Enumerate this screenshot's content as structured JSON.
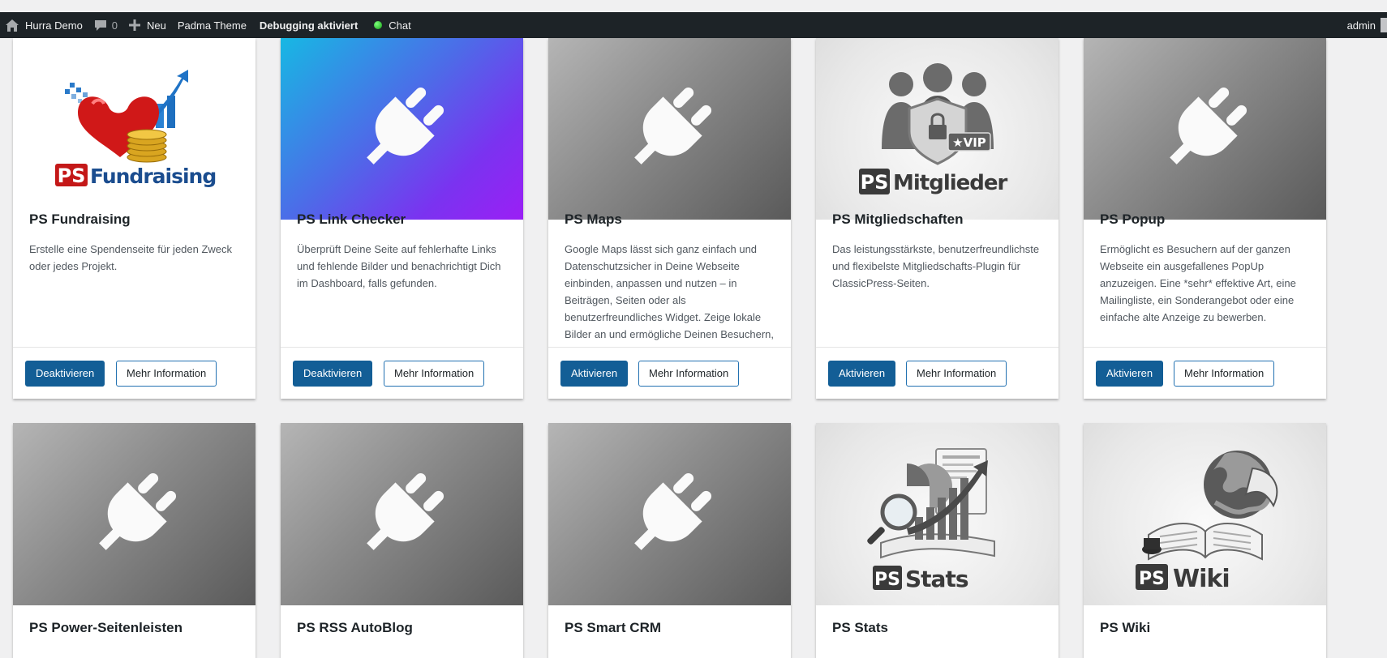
{
  "adminbar": {
    "site_name": "Hurra Demo",
    "comments_count": "0",
    "new_label": "Neu",
    "theme_label": "Padma Theme",
    "debugging_label": "Debugging aktiviert",
    "chat_label": "Chat",
    "user_label": "admin"
  },
  "labels": {
    "more_info": "Mehr Information",
    "activate": "Aktivieren",
    "deactivate": "Deaktivieren"
  },
  "plugins_row1": [
    {
      "name": "PS Fundraising",
      "description": "Erstelle eine Spendenseite für jeden Zweck oder jedes Projekt.",
      "action": "Deaktivieren",
      "thumbnail": "fundraising-logo",
      "logo_text": "Fundraising"
    },
    {
      "name": "PS Link Checker",
      "description": "Überprüft Deine Seite auf fehlerhafte Links und fehlende Bilder und benachrichtigt Dich im Dashboard, falls gefunden.",
      "action": "Deaktivieren",
      "thumbnail": "plug-icon"
    },
    {
      "name": "PS Maps",
      "description": "Google Maps lässt sich ganz einfach und Datenschutzsicher in Deine Webseite einbinden, anpassen und nutzen – in Beiträgen, Seiten oder als benutzerfreundliches Widget. Zeige lokale Bilder an und ermögliche Deinen Besuchern, ...",
      "action": "Aktivieren",
      "thumbnail": "plug-icon"
    },
    {
      "name": "PS Mitgliedschaften",
      "description": "Das leistungsstärkste, benutzerfreundlichste und flexibelste Mitgliedschafts-Plugin für ClassicPress-Seiten.",
      "action": "Aktivieren",
      "thumbnail": "members-logo",
      "logo_text": "Mitglieder",
      "badge_text": "★VIP"
    },
    {
      "name": "PS Popup",
      "description": "Ermöglicht es Besuchern auf der ganzen Webseite ein ausgefallenes PopUp anzuzeigen. Eine *sehr* effektive Art, eine Mailingliste, ein Sonderangebot oder eine einfache alte Anzeige zu bewerben.",
      "action": "Aktivieren",
      "thumbnail": "plug-icon"
    }
  ],
  "plugins_row2": [
    {
      "name": "PS Power-Seitenleisten",
      "thumbnail": "plug-icon"
    },
    {
      "name": "PS RSS AutoBlog",
      "thumbnail": "plug-icon"
    },
    {
      "name": "PS Smart CRM",
      "thumbnail": "plug-icon"
    },
    {
      "name": "PS Stats",
      "thumbnail": "stats-logo",
      "logo_text": "Stats"
    },
    {
      "name": "PS Wiki",
      "thumbnail": "wiki-logo",
      "logo_text": "Wiki"
    }
  ],
  "logo_prefix": "PS",
  "colors": {
    "adminbar": "#1d2327",
    "primary_button": "#135e96",
    "secondary_border": "#2271b1",
    "background": "#f0f0f1"
  }
}
